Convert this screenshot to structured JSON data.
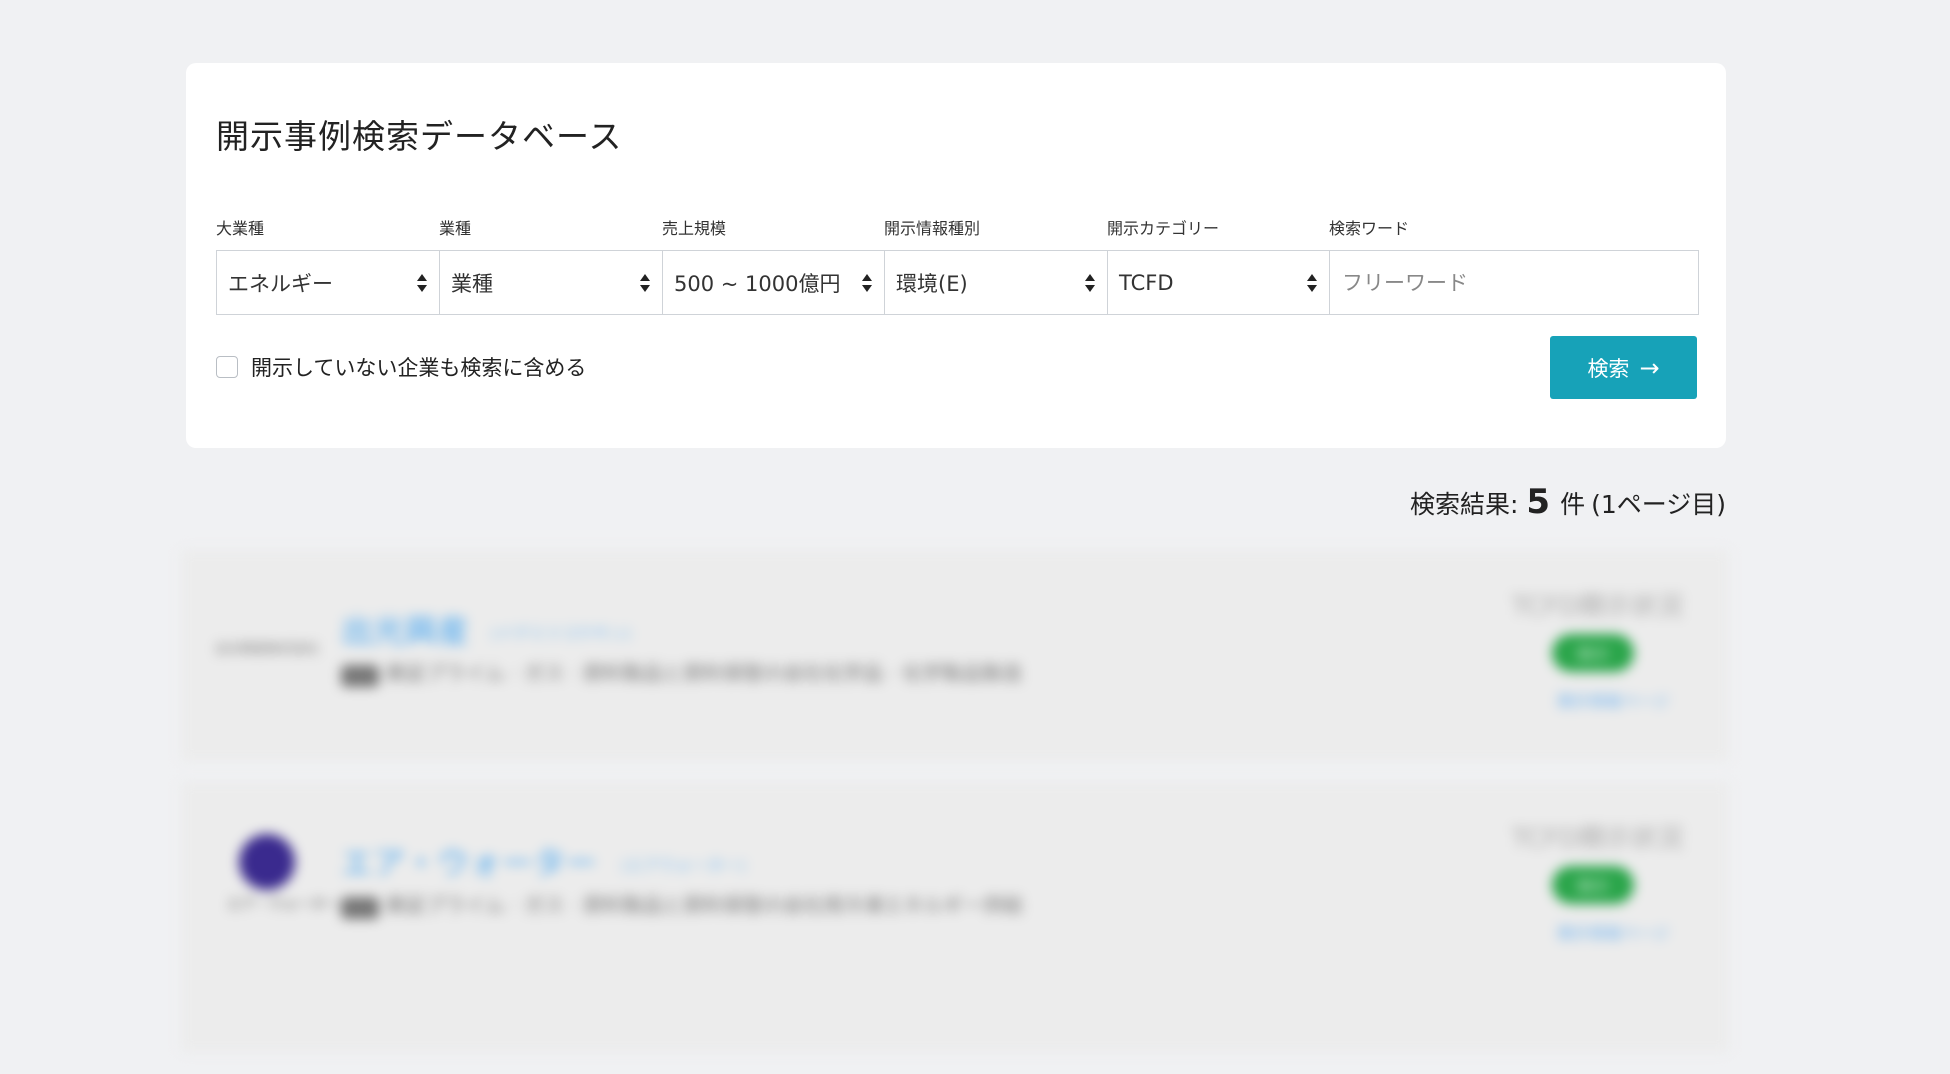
{
  "page": {
    "title": "開示事例検索データベース"
  },
  "filters": [
    {
      "label": "大業種",
      "value": "エネルギー"
    },
    {
      "label": "業種",
      "value": "業種"
    },
    {
      "label": "売上規模",
      "value": "500 ~ 1000億円"
    },
    {
      "label": "開示情報種別",
      "value": "環境(E)"
    },
    {
      "label": "開示カテゴリー",
      "value": "TCFD"
    }
  ],
  "keyword": {
    "label": "検索ワード",
    "placeholder": "フリーワード",
    "value": ""
  },
  "options": {
    "include_non_disclosed_label": "開示していない企業も検索に含める",
    "include_non_disclosed_checked": false
  },
  "actions": {
    "search_label": "検索",
    "search_icon": "arrow-right-icon"
  },
  "results": {
    "prefix": "検索結果:",
    "count": "5",
    "unit": "件",
    "page_info": "(1ページ目)"
  },
  "result_items": [
    {
      "logo_text": "出光興産株式会社",
      "name": "出光興産",
      "kana": "(イデミツコウサン)",
      "meta": "東証プライム · ガス · 原料製品と原料保管の会社化学品 · 化学製品製造",
      "status_title": "TCFD開示状況",
      "status_badge": "開示",
      "status_link": "開示情報ページ"
    },
    {
      "logo_text": "エア・ウォーター",
      "name": "エア・ウォーター",
      "kana": "(エアウォーター)",
      "meta": "東証プライム · ガス · 原料製品と原料保管の会社用冷凍エネルギー供給",
      "status_title": "TCFD開示状況",
      "status_badge": "開示",
      "status_link": "開示情報ページ"
    }
  ],
  "colors": {
    "background": "#f0f1f3",
    "card": "#ffffff",
    "accent": "#17a2b8"
  }
}
